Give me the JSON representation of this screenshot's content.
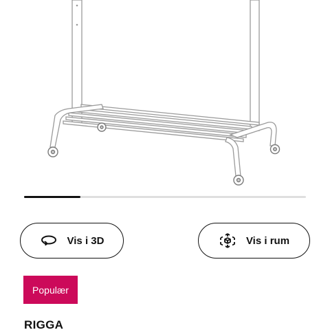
{
  "carousel": {
    "progress": 0.2
  },
  "actions": {
    "view_3d_label": "Vis i 3D",
    "view_in_room_label": "Vis i rum"
  },
  "badge": {
    "label": "Populær",
    "color": "#cc0a5a"
  },
  "product": {
    "name": "RIGGA"
  },
  "icons": {
    "view_3d": "rotate-3d-icon",
    "view_in_room": "ar-cube-icon"
  }
}
